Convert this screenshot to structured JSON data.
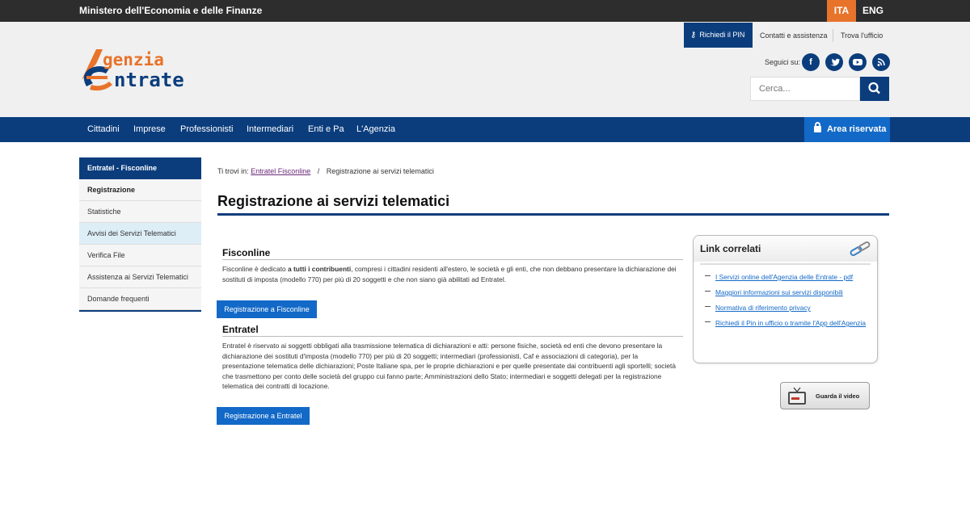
{
  "topbar": {
    "ministry": "Ministero dell'Economia e delle Finanze",
    "lang_ita": "ITA",
    "lang_eng": "ENG"
  },
  "header": {
    "pin_button": "Richiedi il PIN",
    "contatti": "Contatti e assistenza",
    "trova": "Trova l'ufficio",
    "seguici": "Seguici su:",
    "social": [
      "facebook-icon",
      "twitter-icon",
      "youtube-icon",
      "rss-icon"
    ],
    "search_placeholder": "Cerca...",
    "logo_line1": "genzia",
    "logo_line2": "ntrate"
  },
  "nav": {
    "items": [
      "Cittadini",
      "Imprese",
      "Professionisti",
      "Intermediari",
      "Enti e Pa",
      "L'Agenzia"
    ],
    "area_riservata": "Area riservata"
  },
  "sidebar": {
    "heading": "Entratel - Fisconline",
    "items": [
      "Registrazione",
      "Statistiche",
      "Avvisi dei Servizi Telematici",
      "Verifica File",
      "Assistenza ai Servizi Telematici",
      "Domande frequenti"
    ]
  },
  "breadcrumb": {
    "prefix": "Ti trovi in:",
    "link": "Entratel Fisconline",
    "separator": "/",
    "current": "Registrazione ai servizi telematici"
  },
  "main": {
    "title": "Registrazione ai servizi telematici",
    "fisconline": {
      "title": "Fisconline",
      "text_pre": "Fisconline è dedicato ",
      "text_bold": "a tutti i contribuenti",
      "text_post": ", compresi i cittadini residenti all'estero, le società e gli enti, che non debbano presentare la dichiarazione dei sostituti di imposta (modello 770) per più di 20 soggetti e che non siano già abilitati ad Entratel.",
      "button": "Registrazione a Fisconline"
    },
    "entratel": {
      "title": "Entratel",
      "text": "Entratel è riservato ai soggetti obbligati alla trasmissione telematica di dichiarazioni e atti: persone fisiche, società ed enti che devono presentare la dichiarazione dei sostituti d'imposta (modello 770) per più di 20 soggetti; intermediari (professionisti, Caf e associazioni di categoria), per la presentazione telematica delle dichiarazioni; Poste Italiane spa, per le proprie dichiarazioni e per quelle presentate dai contribuenti agli sportelli; società che trasmettono per conto delle società del gruppo cui fanno parte; Amministrazioni dello Stato; intermediari e soggetti delegati per la registrazione telematica dei contratti di locazione.",
      "button": "Registrazione a Entratel"
    }
  },
  "related": {
    "title": "Link correlati",
    "links": [
      "I Servizi online dell'Agenzia delle Entrate - pdf",
      "Maggiori informazioni sui servizi disponibili",
      "Normativa di riferimento privacy",
      "Richiedi il Pin in ufficio o tramite l'App dell'Agenzia"
    ],
    "video_label": "Guarda il video"
  }
}
